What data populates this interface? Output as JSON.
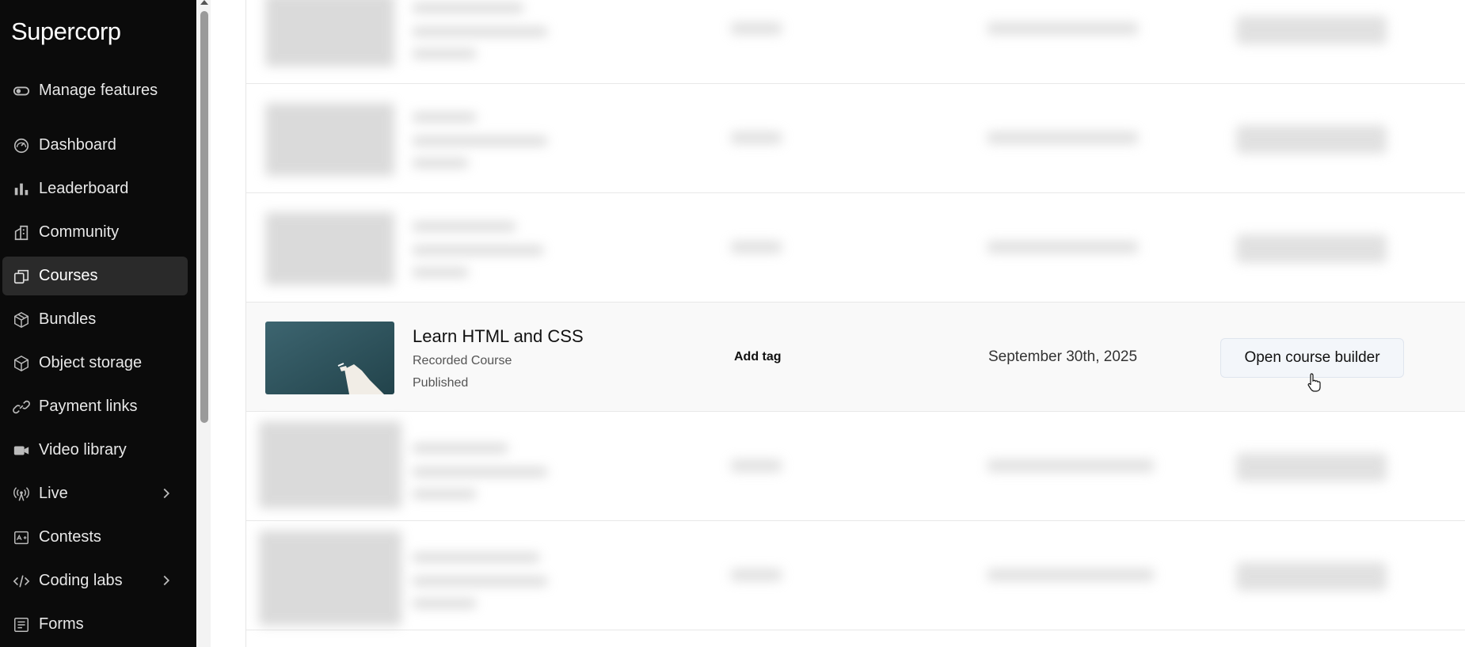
{
  "sidebar": {
    "brand": "Supercorp",
    "items": [
      {
        "label": "Manage features",
        "icon": "toggle-icon"
      },
      {
        "label": "Dashboard",
        "icon": "gauge-icon"
      },
      {
        "label": "Leaderboard",
        "icon": "bar-chart-icon"
      },
      {
        "label": "Community",
        "icon": "buildings-icon"
      },
      {
        "label": "Courses",
        "icon": "copy-icon",
        "active": true
      },
      {
        "label": "Bundles",
        "icon": "package-icon"
      },
      {
        "label": "Object storage",
        "icon": "box-icon"
      },
      {
        "label": "Payment links",
        "icon": "link-icon"
      },
      {
        "label": "Video library",
        "icon": "video-icon"
      },
      {
        "label": "Live",
        "icon": "broadcast-icon",
        "has_submenu": true
      },
      {
        "label": "Contests",
        "icon": "contest-icon"
      },
      {
        "label": "Coding labs",
        "icon": "code-icon",
        "has_submenu": true
      },
      {
        "label": "Forms",
        "icon": "form-icon"
      }
    ]
  },
  "course_row": {
    "title": "Learn HTML and CSS",
    "type": "Recorded Course",
    "status": "Published",
    "tag_action": "Add tag",
    "date": "September 30th, 2025",
    "action_button": "Open course builder"
  },
  "colors": {
    "sidebar_bg": "#0b0b0b",
    "active_item_bg": "#2a2a2a",
    "button_bg": "#f3f6fa",
    "thumbnail_bg": "#355a63"
  }
}
